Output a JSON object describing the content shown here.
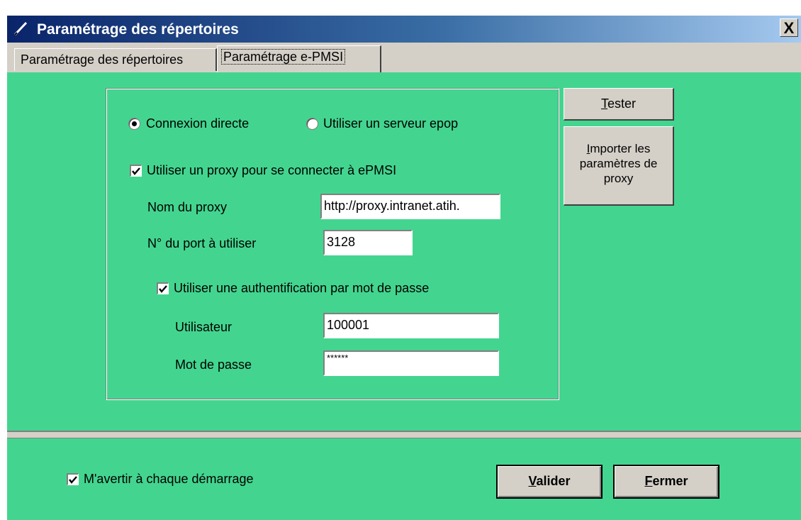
{
  "window": {
    "title": "Paramétrage des répertoires",
    "close_label": "X"
  },
  "tabs": [
    {
      "label": "Paramétrage des répertoires",
      "active": false
    },
    {
      "label": "Paramétrage e-PMSI",
      "active": true
    }
  ],
  "connection": {
    "radio_direct": "Connexion directe",
    "radio_epop": "Utiliser un serveur epop",
    "selected": "direct"
  },
  "proxy": {
    "use_proxy_label": "Utiliser un proxy pour se connecter à ePMSI",
    "use_proxy_checked": true,
    "name_label": "Nom du proxy",
    "name_value": "http://proxy.intranet.atih.",
    "port_label": "N° du port à utiliser",
    "port_value": "3128",
    "auth_label": "Utiliser une authentification par mot de passe",
    "auth_checked": true,
    "user_label": "Utilisateur",
    "user_value": "100001",
    "password_label": "Mot de passe",
    "password_value": "******"
  },
  "side_buttons": {
    "test_first": "T",
    "test_rest": "ester",
    "import_first": "I",
    "import_line1_rest": "mporter les",
    "import_line2": "paramètres de",
    "import_line3": "proxy"
  },
  "footer": {
    "warn_label": "M'avertir à chaque démarrage",
    "warn_checked": true,
    "validate_first": "V",
    "validate_rest": "alider",
    "close_first": "F",
    "close_rest": "ermer"
  },
  "colors": {
    "panel": "#43d58f",
    "titlebar_start": "#0a246a",
    "titlebar_end": "#a6caf0",
    "chrome": "#d4d0c8"
  }
}
